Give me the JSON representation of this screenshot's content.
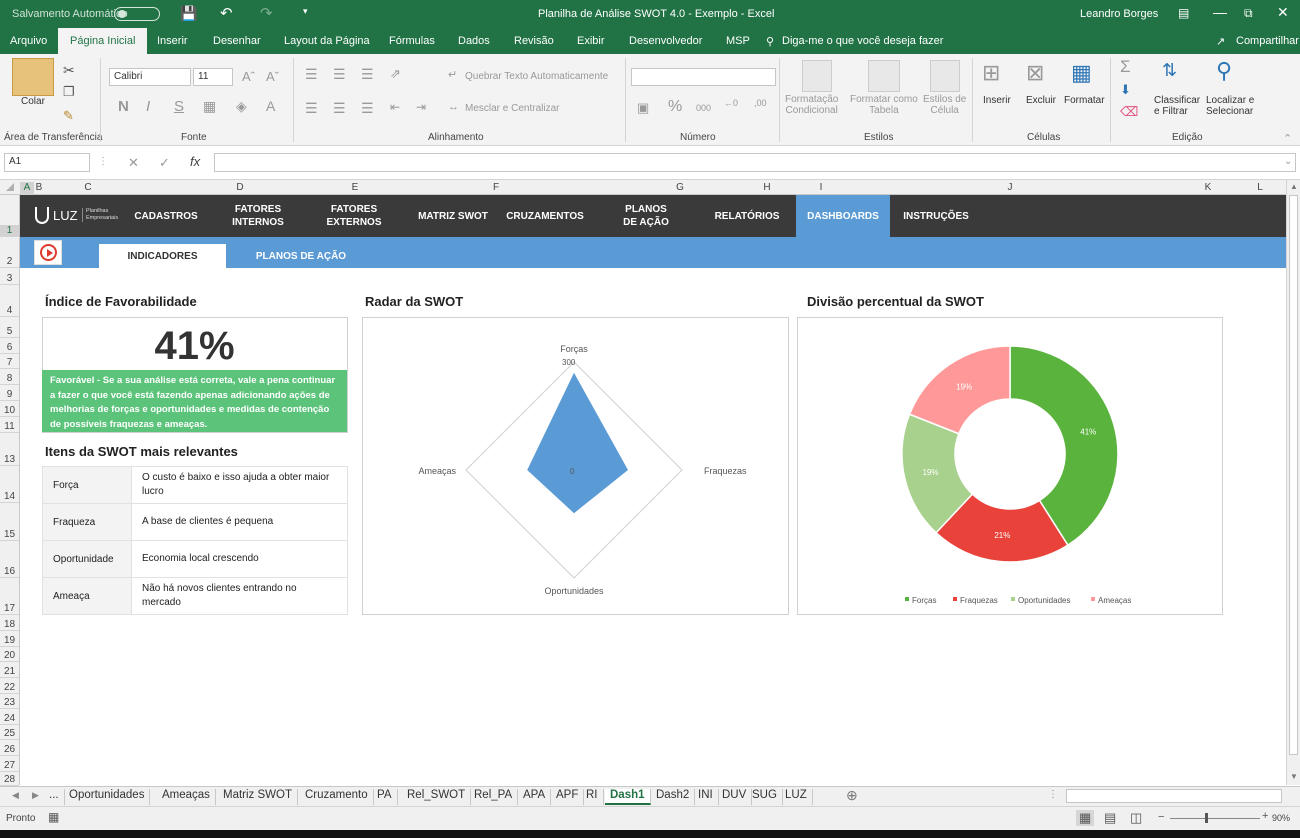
{
  "titlebar": {
    "autosave": "Salvamento Automático",
    "title": "Planilha de Análise SWOT 4.0 - Exemplo  -  Excel",
    "user": "Leandro Borges"
  },
  "tabs": [
    "Arquivo",
    "Página Inicial",
    "Inserir",
    "Desenhar",
    "Layout da Página",
    "Fórmulas",
    "Dados",
    "Revisão",
    "Exibir",
    "Desenvolvedor",
    "MSP"
  ],
  "tellme": "Diga-me o que você deseja fazer",
  "share": "Compartilhar",
  "ribbon": {
    "paste": "Colar",
    "clipboard": "Área de Transferência",
    "font_name": "Calibri",
    "font_size": "11",
    "font_group": "Fonte",
    "wrap": "Quebrar Texto Automaticamente",
    "merge": "Mesclar e Centralizar",
    "align_group": "Alinhamento",
    "number_group": "Número",
    "cond_format": "Formatação\nCondicional",
    "format_table": "Formatar como\nTabela",
    "cell_styles": "Estilos de\nCélula",
    "styles_group": "Estilos",
    "insert": "Inserir",
    "delete": "Excluir",
    "format": "Formatar",
    "cells_group": "Células",
    "sort": "Classificar\ne Filtrar",
    "find": "Localizar e\nSelecionar",
    "edit_group": "Edição"
  },
  "namebox": "A1",
  "columns": [
    "A",
    "B",
    "C",
    "D",
    "E",
    "F",
    "G",
    "H",
    "I",
    "J",
    "K",
    "L"
  ],
  "rows": [
    "1",
    "2",
    "3",
    "4",
    "5",
    "6",
    "7",
    "8",
    "9",
    "10",
    "11",
    "13",
    "14",
    "15",
    "16",
    "17",
    "18",
    "19",
    "20",
    "21",
    "22",
    "23",
    "24",
    "25",
    "26",
    "27",
    "28"
  ],
  "nav": {
    "logo": "LUZ",
    "logo_sub": "Planilhas\nEmpresariais",
    "items": [
      "CADASTROS",
      "FATORES\nINTERNOS",
      "FATORES\nEXTERNOS",
      "MATRIZ SWOT",
      "CRUZAMENTOS",
      "PLANOS\nDE AÇÃO",
      "RELATÓRIOS",
      "DASHBOARDS",
      "INSTRUÇÕES"
    ]
  },
  "subtabs": [
    "INDICADORES",
    "PLANOS DE AÇÃO"
  ],
  "fav": {
    "title": "Índice de Favorabilidade",
    "value": "41%",
    "text": "Favorável - Se a sua análise está correta, vale a pena continuar a fazer o que você está fazendo apenas adicionando ações de melhorias de forças e oportunidades e medidas de contenção de possíveis fraquezas e ameaças."
  },
  "items": {
    "title": "Itens da SWOT mais relevantes",
    "rows": [
      {
        "k": "Força",
        "v": "O custo é baixo e isso ajuda a obter maior lucro"
      },
      {
        "k": "Fraqueza",
        "v": "A base de clientes é pequena"
      },
      {
        "k": "Oportunidade",
        "v": "Economia local crescendo"
      },
      {
        "k": "Ameaça",
        "v": "Não há novos clientes entrando no mercado"
      }
    ]
  },
  "radar_title": "Radar da SWOT",
  "donut_title": "Divisão percentual da SWOT",
  "chart_data": [
    {
      "type": "radar",
      "title": "Radar da SWOT",
      "categories": [
        "Forças",
        "Fraquezas",
        "Oportunidades",
        "Ameaças"
      ],
      "values": [
        270,
        150,
        120,
        130
      ],
      "rmax": 300,
      "tick_labels": [
        "0",
        "300"
      ],
      "color": "#5b9bd5"
    },
    {
      "type": "pie",
      "title": "Divisão percentual da SWOT",
      "categories": [
        "Forças",
        "Fraquezas",
        "Oportunidades",
        "Ameaças"
      ],
      "values": [
        41,
        21,
        19,
        19
      ],
      "labels": [
        "41%",
        "21%",
        "19%",
        "19%"
      ],
      "colors": [
        "#5ab33c",
        "#e8423a",
        "#a9d18e",
        "#ff9999"
      ],
      "legend": "bottom"
    }
  ],
  "sheets": [
    "...",
    "Oportunidades",
    "Ameaças",
    "Matriz SWOT",
    "Cruzamento",
    "PA",
    "Rel_SWOT",
    "Rel_PA",
    "APA",
    "APF",
    "RI",
    "Dash1",
    "Dash2",
    "INI",
    "DUV",
    "SUG",
    "LUZ"
  ],
  "active_sheet": "Dash1",
  "status": {
    "ready": "Pronto",
    "zoom": "90%"
  }
}
